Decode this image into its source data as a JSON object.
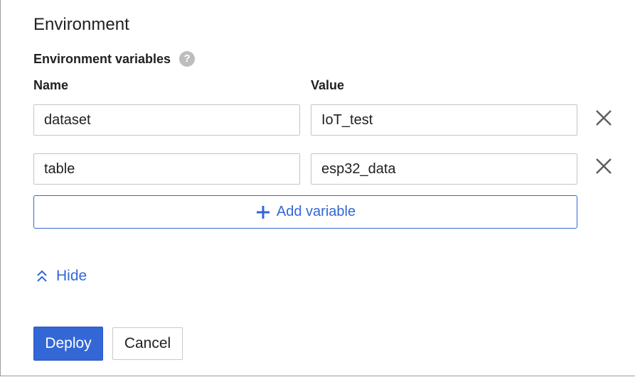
{
  "section": {
    "title": "Environment"
  },
  "env_vars": {
    "title": "Environment variables",
    "help_icon": "?",
    "col_name": "Name",
    "col_value": "Value",
    "rows": [
      {
        "name": "dataset",
        "value": "IoT_test"
      },
      {
        "name": "table",
        "value": "esp32_data"
      }
    ],
    "add_label": "Add variable"
  },
  "toggle": {
    "label": "Hide"
  },
  "actions": {
    "deploy_label": "Deploy",
    "cancel_label": "Cancel"
  },
  "colors": {
    "accent": "#3367d6",
    "icon_gray": "#616161",
    "help_gray": "#bdbdbd",
    "border": "#c4c4c4"
  },
  "icons": {
    "remove": "close-icon",
    "add": "plus-icon",
    "hide": "chevron-double-up-icon",
    "help": "help-icon"
  }
}
